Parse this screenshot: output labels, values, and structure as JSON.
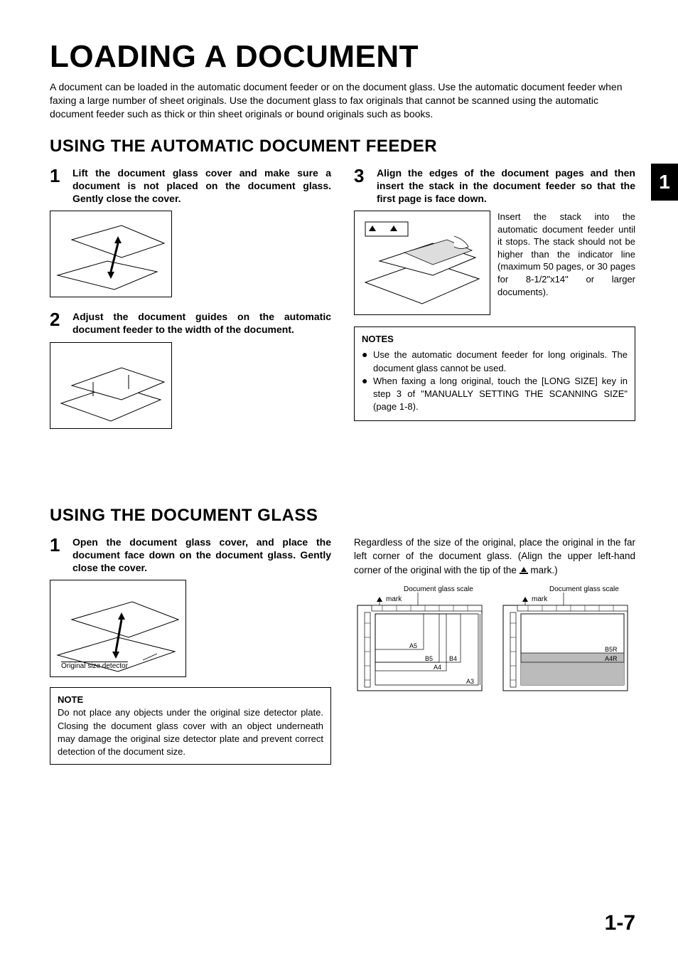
{
  "title": "LOADING A DOCUMENT",
  "intro": "A document can be loaded in the automatic document feeder or on the document glass. Use the automatic document feeder when faxing a large number of sheet originals. Use the document glass to fax originals that cannot be scanned using the automatic document feeder such as thick or thin sheet originals or bound originals such as books.",
  "section1": {
    "heading": "USING THE AUTOMATIC DOCUMENT FEEDER",
    "step1": {
      "num": "1",
      "text": "Lift the document glass cover and make sure a document is not placed on the document glass. Gently close the cover."
    },
    "step2": {
      "num": "2",
      "text": "Adjust the document guides on the automatic document feeder to the width of the document."
    },
    "step3": {
      "num": "3",
      "text": "Align the edges of the document pages and then insert the stack in the document feeder so that the first page is face down.",
      "caption": "Insert the stack into the automatic document feeder until it stops. The stack should not be higher than the indicator line (maximum 50 pages, or 30 pages for 8-1/2\"x14\" or larger documents)."
    },
    "notes": {
      "title": "NOTES",
      "items": [
        "Use the automatic document feeder for long originals. The document glass cannot be used.",
        "When faxing a long original, touch the [LONG SIZE] key in step 3 of \"MANUALLY SETTING THE SCANNING SIZE\" (page 1-8)."
      ]
    }
  },
  "section2": {
    "heading": "USING THE DOCUMENT GLASS",
    "step1": {
      "num": "1",
      "text": "Open the document glass cover, and place the document face down on the document glass. Gently close the cover."
    },
    "fig_label": "Original size detector",
    "note": {
      "title": "NOTE",
      "body": "Do not place any objects under the original size detector plate. Closing the document glass cover with an object underneath may damage the original size detector plate and prevent correct detection of the document size."
    },
    "right_text_pre": "Regardless of the size of the original, place the original in the far left corner of the document glass. (Align the upper left-hand corner of the original with the tip of the ",
    "right_text_post": " mark.)",
    "diag": {
      "scale_label": "Document glass scale",
      "mark_label": "mark",
      "sizes_left": {
        "A5": "A5",
        "B5": "B5",
        "B4": "B4",
        "A4": "A4",
        "A3": "A3"
      },
      "sizes_right": {
        "B5R": "B5R",
        "A4R": "A4R"
      }
    }
  },
  "tab": "1",
  "page_number": "1-7"
}
